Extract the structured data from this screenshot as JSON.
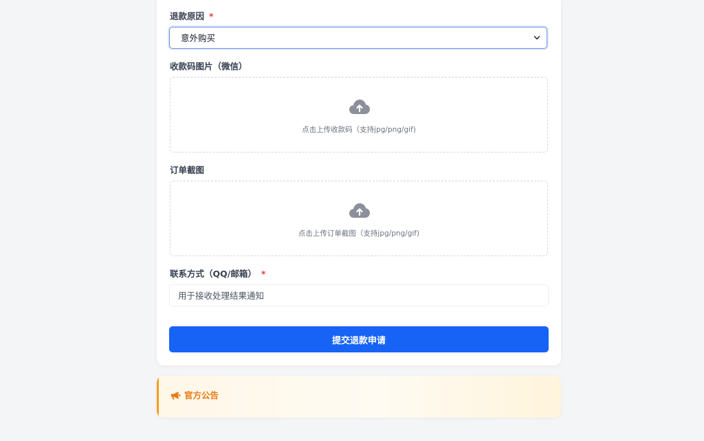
{
  "form": {
    "refund_reason": {
      "label": "退款原因",
      "required_mark": "*",
      "selected": "意外购买"
    },
    "payment_qr": {
      "label": "收款码图片（微信）",
      "hint": "点击上传收款码（支持jpg/png/gif)",
      "icon": "cloud-upload-icon"
    },
    "order_screenshot": {
      "label": "订单截图",
      "hint": "点击上传订单截图（支持jpg/png/gif)",
      "icon": "cloud-upload-icon"
    },
    "contact": {
      "label": "联系方式（QQ/邮箱）",
      "required_mark": "*",
      "placeholder": "用于接收处理结果通知",
      "value": ""
    },
    "submit_label": "提交退款申请"
  },
  "notice": {
    "title": "官方公告",
    "icon": "megaphone-icon"
  },
  "colors": {
    "primary": "#1763f5",
    "required": "#e53e3e",
    "notice_accent": "#f59f1f",
    "notice_text": "#ea7a13",
    "icon_gray": "#8b909a"
  }
}
